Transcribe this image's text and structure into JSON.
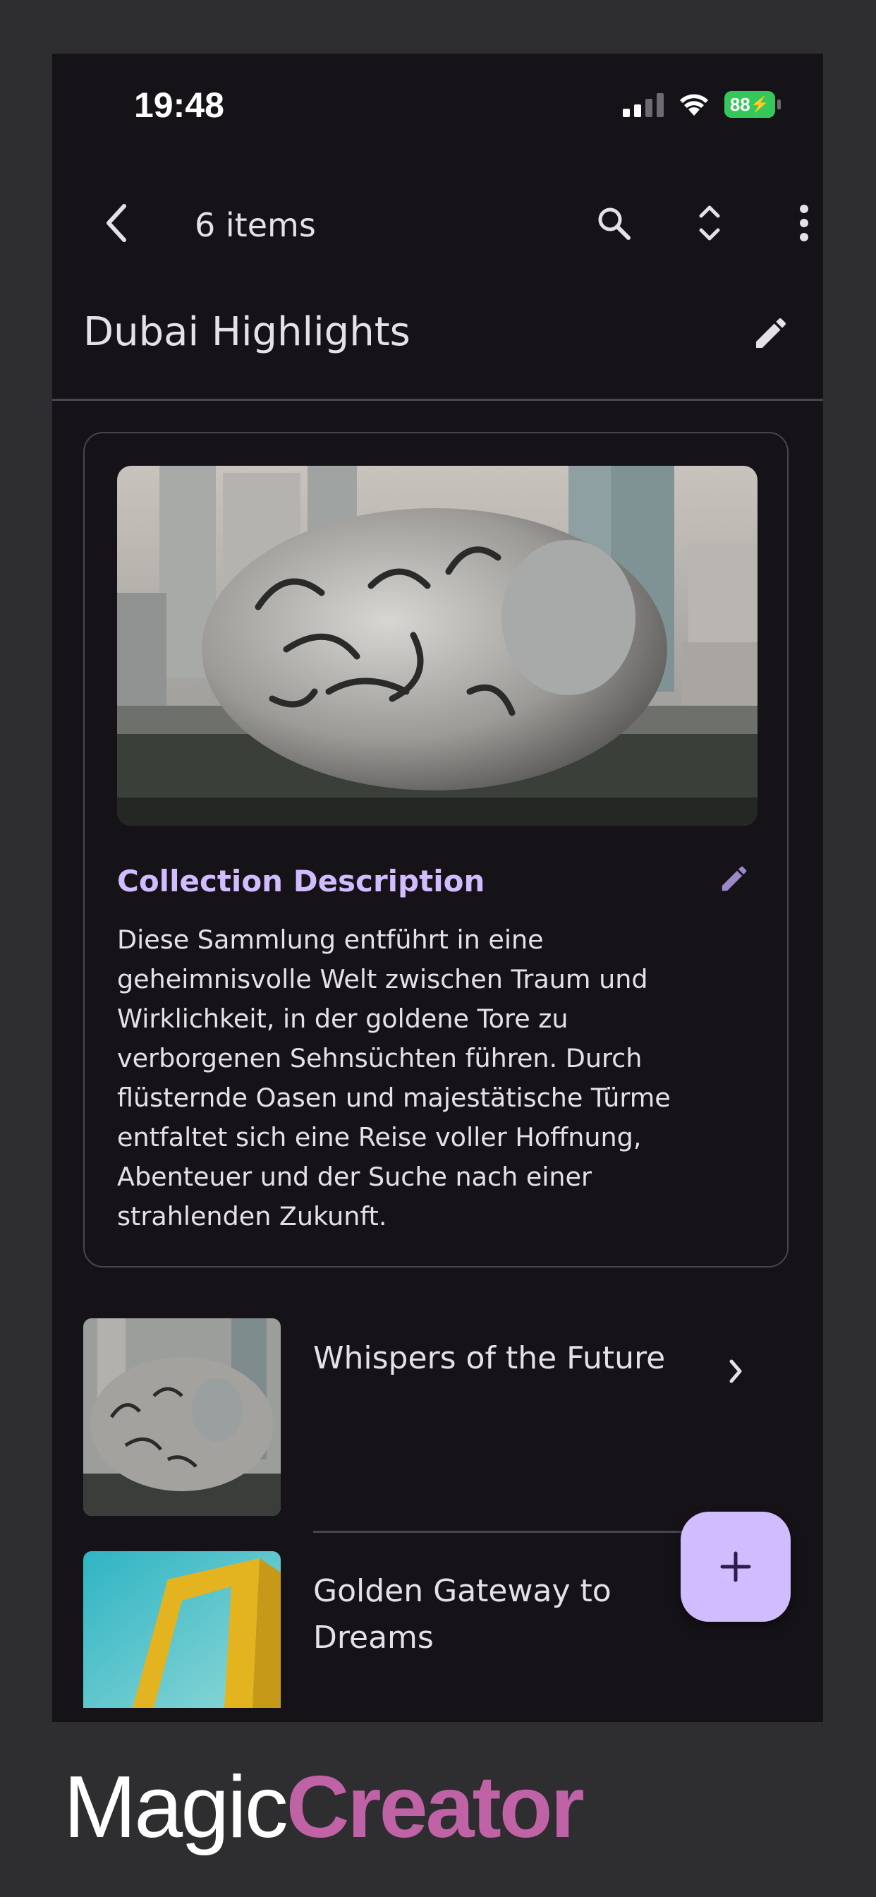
{
  "status_bar": {
    "time": "19:48",
    "battery": "88"
  },
  "toolbar": {
    "items_count": "6 items",
    "icons": [
      "back-arrow-icon",
      "search-icon",
      "expand-collapse-icon",
      "more-vert-icon"
    ]
  },
  "collection": {
    "title": "Dubai Highlights"
  },
  "description": {
    "heading": "Collection Description",
    "text": "Diese Sammlung entführt in eine geheimnisvolle Welt zwischen Traum und Wirklichkeit, in der goldene Tore zu verborgenen Sehnsüchten führen. Durch flüsternde Oasen und majestätische Türme entfaltet sich eine Reise voller Hoffnung, Abenteuer und der Suche nach einer strahlenden Zukunft."
  },
  "items": [
    {
      "title": "Whispers of the Future"
    },
    {
      "title": "Golden Gateway to Dreams"
    }
  ],
  "fab": {
    "icon": "plus-icon"
  },
  "branding": {
    "magic": "Magic",
    "creator": "Creator"
  },
  "colors": {
    "accent": "#d0bcff",
    "background": "#151318",
    "brand": "#c062a6",
    "battery": "#34c759"
  }
}
